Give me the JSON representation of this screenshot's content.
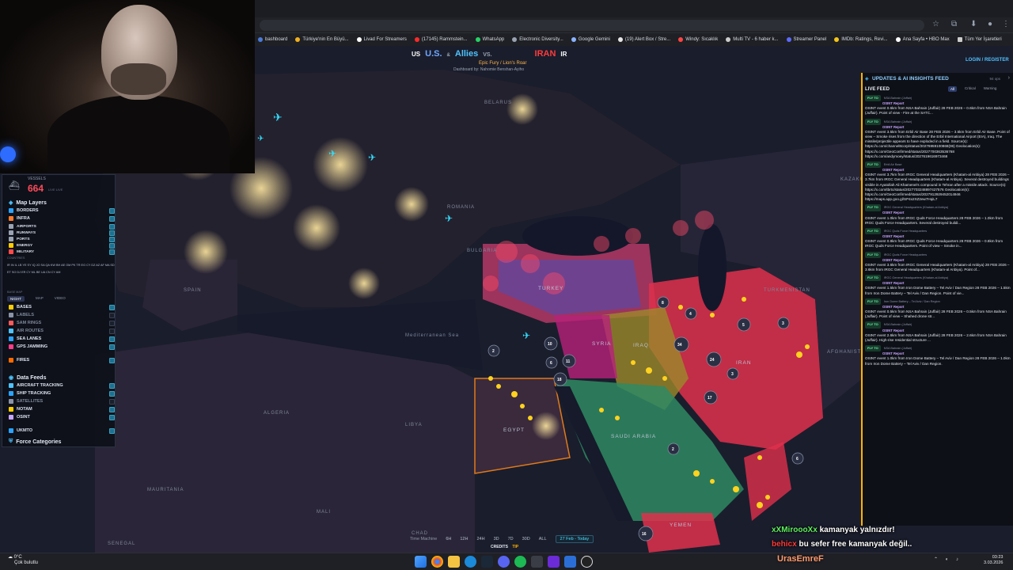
{
  "browser": {
    "bookmarks": [
      {
        "label": "bashboard",
        "color": "#4b7bd8"
      },
      {
        "label": "Türkiye'nin En Büyü...",
        "color": "#f2b01e"
      },
      {
        "label": "Livad For Streamers",
        "color": "#ffffff"
      },
      {
        "label": "(17145) Rammstein...",
        "color": "#ff2a2a"
      },
      {
        "label": "WhatsApp",
        "color": "#25d366"
      },
      {
        "label": "Electronic Diversity...",
        "color": "#9aa3b2"
      },
      {
        "label": "Google Gemini",
        "color": "#8ab4ff"
      },
      {
        "label": "(19) Alert Box / Stre...",
        "color": "#e7e7e7"
      },
      {
        "label": "Windy: Sıcaklık",
        "color": "#ff4444"
      },
      {
        "label": "Multi TV - 6 haber k...",
        "color": "#cccccc"
      },
      {
        "label": "Streamer Panel",
        "color": "#5b6bff"
      },
      {
        "label": "IMDb: Ratings, Revi...",
        "color": "#f5c518"
      },
      {
        "label": "Ana Sayfa • HBO Max",
        "color": "#ffffff"
      },
      {
        "label": "Tüm Yer İşaretleri",
        "color": "#cccccc"
      }
    ]
  },
  "dashboard": {
    "title_us_flag": "US",
    "title_us": "U.S.",
    "title_amp": "&",
    "title_allies": "Allies",
    "title_vs": "VS.",
    "title_iran": "IRAN",
    "title_ir": "IR",
    "subtitle": "Epic Fury / Lion's Roar",
    "credit": "Dashboard by: Nahomie Benshan-Ayiho",
    "login": "LOGIN / REGISTER"
  },
  "left_panel": {
    "vessels_label": "VESSELS",
    "vessels_value": "664",
    "vessels_unit": "LIVE LIVE",
    "map_layers_title": "Map Layers",
    "layers": [
      {
        "label": "BORDERS",
        "color": "#2aa3ff",
        "on": true
      },
      {
        "label": "INFRA",
        "color": "#ff7a2a",
        "on": true
      },
      {
        "label": "AIRPORTS",
        "color": "#9aa3b2",
        "on": true
      },
      {
        "label": "RUNWAYS",
        "color": "#9aa3b2",
        "on": true
      },
      {
        "label": "PORTS",
        "color": "#9aa3b2",
        "on": true
      },
      {
        "label": "ENERGY",
        "color": "#ffcc00",
        "on": true
      },
      {
        "label": "MILITARY",
        "color": "#ff4a4a",
        "on": true
      }
    ],
    "countries_label": "COUNTRIES",
    "countries": "IR IN IL LB YE SY IQ JO SA QA KW BH AE OM PK TR EG CY DZ AZ AF MA SD ET SO DJ ER CY ML BE UA CN CY AM",
    "basemap_label": "BASE MAP",
    "basemap_tabs": [
      "NIGHT",
      "MAP",
      "VIDEO"
    ],
    "overlays": [
      {
        "label": "BASES",
        "color": "#ffcc00",
        "on": true
      },
      {
        "label": "LABELS",
        "color": "#8a93a6",
        "on": false
      },
      {
        "label": "SAM RINGS",
        "color": "#ff5a5a",
        "on": false
      },
      {
        "label": "AIR ROUTES",
        "color": "#4fc3ff",
        "on": false
      },
      {
        "label": "SEA LANES",
        "color": "#2aa3ff",
        "on": true
      },
      {
        "label": "GPS JAMMING",
        "color": "#ff3b8a",
        "on": true
      },
      {
        "label": "FIRES",
        "color": "#ff6a00",
        "on": true
      }
    ],
    "data_feeds_title": "Data Feeds",
    "feeds": [
      {
        "label": "AIRCRAFT TRACKING",
        "color": "#4fc3ff",
        "on": true
      },
      {
        "label": "SHIP TRACKING",
        "color": "#2aa3ff",
        "on": true
      },
      {
        "label": "SATELLITES",
        "color": "#8a93a6",
        "on": false
      },
      {
        "label": "NOTAM",
        "color": "#ffcc00",
        "on": true
      },
      {
        "label": "OSINT",
        "color": "#c8a6ff",
        "on": true
      },
      {
        "label": "UKMTO",
        "color": "#2aa3ff",
        "on": true
      }
    ],
    "force_categories": "Force Categories"
  },
  "map_labels": [
    {
      "text": "BELARUS"
    },
    {
      "text": "ROMANIA"
    },
    {
      "text": "BULGARIA"
    },
    {
      "text": "TURKEY"
    },
    {
      "text": "SYRIA"
    },
    {
      "text": "IRAQ"
    },
    {
      "text": "IRAN"
    },
    {
      "text": "EGYPT"
    },
    {
      "text": "LIBYA"
    },
    {
      "text": "ALGERIA"
    },
    {
      "text": "MAURITANIA"
    },
    {
      "text": "SAUDI ARABIA"
    },
    {
      "text": "TURKMENISTAN"
    },
    {
      "text": "AFGHANISTAN"
    },
    {
      "text": "YEMEN"
    },
    {
      "text": "SPAIN"
    },
    {
      "text": "MALI"
    },
    {
      "text": "CHAD"
    },
    {
      "text": "SENEGAL"
    },
    {
      "text": "Mediterranean Sea"
    },
    {
      "text": "KAZAKH"
    }
  ],
  "clusters": [
    "10",
    "5",
    "34",
    "24",
    "3",
    "2",
    "6",
    "11",
    "18",
    "17",
    "4",
    "6",
    "2",
    "8",
    "16",
    "3"
  ],
  "feed": {
    "title": "UPDATES & AI INSIGHTS FEED",
    "count": "94 ops",
    "live": "LIVE FEED",
    "tabs": [
      "All",
      "Critical",
      "Warning"
    ],
    "entries": [
      {
        "fly": "FLY TO",
        "place": "NSA Bahrain (Juffair)",
        "body": "OSINT event 0.6km from NSA Bahrain (Juffair) 28 FEB 2026 – 0.6km from NSA Bahrain (Juffair). Point of view - Fire at the SATC..."
      },
      {
        "fly": "FLY TO",
        "place": "NSA Bahrain (Juffair)",
        "body": "OSINT event 3.5km from Erbil Air Base 28 FEB 2026 – 3.5km from Erbil Air Base. Point of view – Smoke rises from the direction of the Erbil International Airport (EIA), Iraq. The missile/projectile appears to have exploded in a field. Source(s): https://x.com/channel8corp/status/20276959100868(06) Geolocation(s): https://x.com/GeoConfirmed/status/2027700363536768 https://x.com/andymoey/status/2027619616973468"
      },
      {
        "fly": "FLY TO",
        "place": "Erbil Air Base",
        "body": "OSINT event 3.7km from IRGC General Headquarters (Khatam-al Anbiya) 28 FEB 2026 – 3.7km from IRGC General Headquarters (Khatam-al Anbiya). Several destroyed buildings visible in Ayatollah Ali Khamenei's compound in Tehran after a missile attack. Source(s): https://x.com/tbrtc/status/2027703248897427576 Geolocation(s): https://x.com/GeoConfirmed/status/2027912929452014946 https://maps.app.goo.gl/SP4x2XZ2ew7HqiL7"
      },
      {
        "fly": "FLY TO",
        "place": "IRGC General Headquarters (Khatam-al Anbiya)",
        "body": "OSINT event 1.0km from IRGC Quds Force Headquarters 28 FEB 2026 – 1.0km from IRGC Quds Force Headquarters. Several destroyed buildi..."
      },
      {
        "fly": "FLY TO",
        "place": "IRGC Quds Force Headquarters",
        "body": "OSINT event 0.8km from IRGC Quds Force Headquarters 28 FEB 2026 – 0.8km from IRGC Quds Force Headquarters. Point of view – Smoke in..."
      },
      {
        "fly": "FLY TO",
        "place": "IRGC Quds Force Headquarters",
        "body": "OSINT event 3.6km from IRGC General Headquarters (Khatam-al Anbiya) 28 FEB 2026 – 3.6km from IRGC General Headquarters (Khatam-al Anbiya). Point of..."
      },
      {
        "fly": "FLY TO",
        "place": "IRGC General Headquarters (Khatam-al Anbiya)",
        "body": "OSINT event 1.5km from Iron Dome Battery – Tel Aviv / Dan Region 28 FEB 2026 – 1.5km from Iron Dome Battery – Tel Aviv / Dan Region. Point of vie..."
      },
      {
        "fly": "FLY TO",
        "place": "Iron Dome Battery – Tel Aviv / Dan Region",
        "body": "OSINT event 0.5km from NSA Bahrain (Juffair) 28 FEB 2026 – 0.5km from NSA Bahrain (Juffair). Point of view – Shahed drone str..."
      },
      {
        "fly": "FLY TO",
        "place": "NSA Bahrain (Juffair)",
        "body": "OSINT event 2.6km from NSA Bahrain (Juffair) 28 FEB 2026 – 2.6km from NSA Bahrain (Juffair). High-rise residential structure ..."
      },
      {
        "fly": "FLY TO",
        "place": "NSA Bahrain (Juffair)",
        "body": "OSINT event 1.0km from Iron Dome Battery – Tel Aviv / Dan Region 28 FEB 2026 – 1.0km from Iron Dome Battery – Tel Aviv / Dan Region."
      }
    ],
    "osint_label": "OSINT Report"
  },
  "timebar": {
    "label": "Time Machine",
    "options": [
      "6H",
      "12H",
      "24H",
      "3D",
      "7D",
      "30D",
      "ALL"
    ],
    "today": "27 Feb - Today",
    "credits": "CREDITS",
    "tip": "TIP"
  },
  "chat": [
    {
      "user": "xXMiroooXx",
      "message": "kamanyak yalnızdır!",
      "color": "#5ef05e"
    },
    {
      "user": "behicx",
      "message": "bu sefer free kamanyak değil..",
      "color": "#ff3b3b"
    }
  ],
  "streamer": "UrasEmreF",
  "taskbar": {
    "temp": "0°C",
    "weather": "Çok bulutlu",
    "time": "03:23",
    "date": "3.03.2026"
  }
}
